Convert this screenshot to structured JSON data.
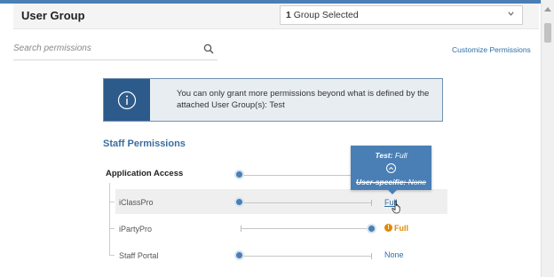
{
  "header": {
    "title": "User Group",
    "group_select": {
      "count": "1",
      "text": " Group Selected"
    }
  },
  "search": {
    "placeholder": "Search permissions",
    "icon": "search-icon"
  },
  "customize_link": "Customize Permissions",
  "notice": {
    "icon": "info-icon",
    "text": "You can only grant more permissions beyond what is defined by the attached User Group(s): Test"
  },
  "section": {
    "title": "Staff Permissions"
  },
  "rows": [
    {
      "label": "Application Access",
      "value": ""
    },
    {
      "label": "iClassPro",
      "value": "Full"
    },
    {
      "label": "iPartyPro",
      "value": "Full"
    },
    {
      "label": "Staff Portal",
      "value": "None"
    }
  ],
  "tooltip": {
    "line1_prefix": "Test:",
    "line1_value": " Full",
    "line2_prefix": "User-specific:",
    "line2_value": " None"
  },
  "colors": {
    "accent": "#4a7fb5",
    "notice_dark": "#2c5a8a",
    "warning": "#e08a00"
  }
}
